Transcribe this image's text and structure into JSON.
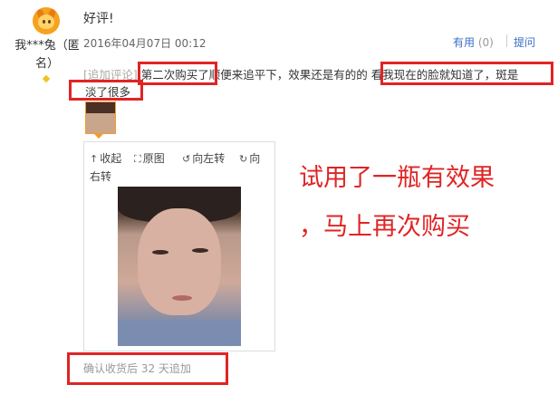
{
  "review": {
    "user": {
      "name": "我***兔（匿名）"
    },
    "title": "好评!",
    "date": {
      "partial": "2016年04月07日 00:12"
    },
    "useful_label": "有用",
    "useful_count": "(0)",
    "ask_label": "提问",
    "followup": {
      "tag": "[追加评论]",
      "text_a": "第二次购买了顺便来追平下，效果还是有的的",
      "text_b": "看我现在的脸就知道了，斑是",
      "text_c": "淡了很多"
    },
    "viewer": {
      "collapse": "收起",
      "original": "原图",
      "rotate_left": "向左转",
      "rotate_right_a": "向",
      "rotate_right_b": "右转"
    },
    "followup_time": "确认收货后 32 天追加"
  },
  "annotation": {
    "line1": "试用了一瓶有效果",
    "line2": "，马上再次购买"
  },
  "colors": {
    "highlight_box": "#e02424",
    "link": "#3a6ec9",
    "annotation_text": "#e02424"
  },
  "icons": {
    "collapse": "arrow-up-icon",
    "original": "expand-icon",
    "rotate_left": "rotate-left-icon",
    "rotate_right": "rotate-right-icon"
  }
}
